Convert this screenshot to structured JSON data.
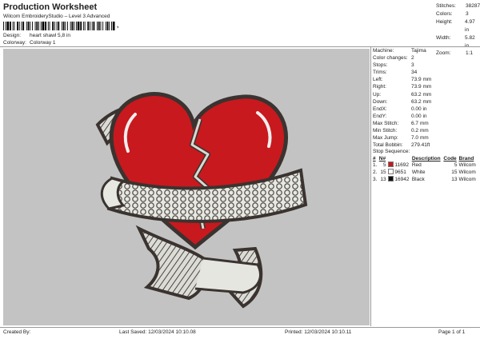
{
  "header": {
    "title": "Production Worksheet",
    "subtitle": "Wilcom EmbroideryStudio – Level 3 Advanced",
    "barcode_mark": ","
  },
  "design_info": [
    {
      "label": "Design:",
      "value": "heart shawl 5,8 in"
    },
    {
      "label": "Colorway:",
      "value": "Colorway 1"
    }
  ],
  "stats": [
    {
      "label": "Stitches:",
      "value": "38287"
    },
    {
      "label": "Colors:",
      "value": "3"
    },
    {
      "label": "Height:",
      "value": "4.97 in"
    },
    {
      "label": "Width:",
      "value": "5.82 in"
    },
    {
      "label": "Zoom:",
      "value": "1:1"
    }
  ],
  "machine_props": [
    {
      "label": "Machine:",
      "value": "Tajima"
    },
    {
      "label": "Color changes:",
      "value": "2"
    },
    {
      "label": "Stops:",
      "value": "3"
    },
    {
      "label": "Trims:",
      "value": "34"
    },
    {
      "label": "Left:",
      "value": "73.9 mm"
    },
    {
      "label": "Right:",
      "value": "73.9 mm"
    },
    {
      "label": "Up:",
      "value": "63.2 mm"
    },
    {
      "label": "Down:",
      "value": "63.2 mm"
    },
    {
      "label": "EndX:",
      "value": "0.00 in"
    },
    {
      "label": "EndY:",
      "value": "0.00 in"
    },
    {
      "label": "Max Stitch:",
      "value": "6.7 mm"
    },
    {
      "label": "Min Stitch:",
      "value": "0.2 mm"
    },
    {
      "label": "Max Jump:",
      "value": "7.0 mm"
    },
    {
      "label": "Total Bobbin:",
      "value": "279.41ft"
    }
  ],
  "stop_sequence": {
    "title": "Stop Sequence:",
    "headers": [
      "#",
      "N#",
      "",
      "Description",
      "Code",
      "Brand"
    ],
    "rows": [
      {
        "idx": "1.",
        "n": "5",
        "color": "#c8191e",
        "num": "11692",
        "desc": "Red",
        "code": "5",
        "brand": "Wilcom"
      },
      {
        "idx": "2.",
        "n": "15",
        "color": "#ffffff",
        "num": "9651",
        "desc": "White",
        "code": "15",
        "brand": "Wilcom"
      },
      {
        "idx": "3.",
        "n": "13",
        "color": "#111111",
        "num": "16942",
        "desc": "Black",
        "code": "13",
        "brand": "Wilcom"
      }
    ]
  },
  "footer": {
    "created_by": "Created By:",
    "last_saved": "Last Saved: 12/03/2024 10:10.08",
    "printed": "Printed: 12/03/2024 10:10.11",
    "page": "Page 1 of 1"
  },
  "colors": {
    "canvas_bg": "#c3c3c3",
    "heart_red": "#c8191e",
    "outline": "#3a3330",
    "ribbon": "#e6e6e0"
  }
}
